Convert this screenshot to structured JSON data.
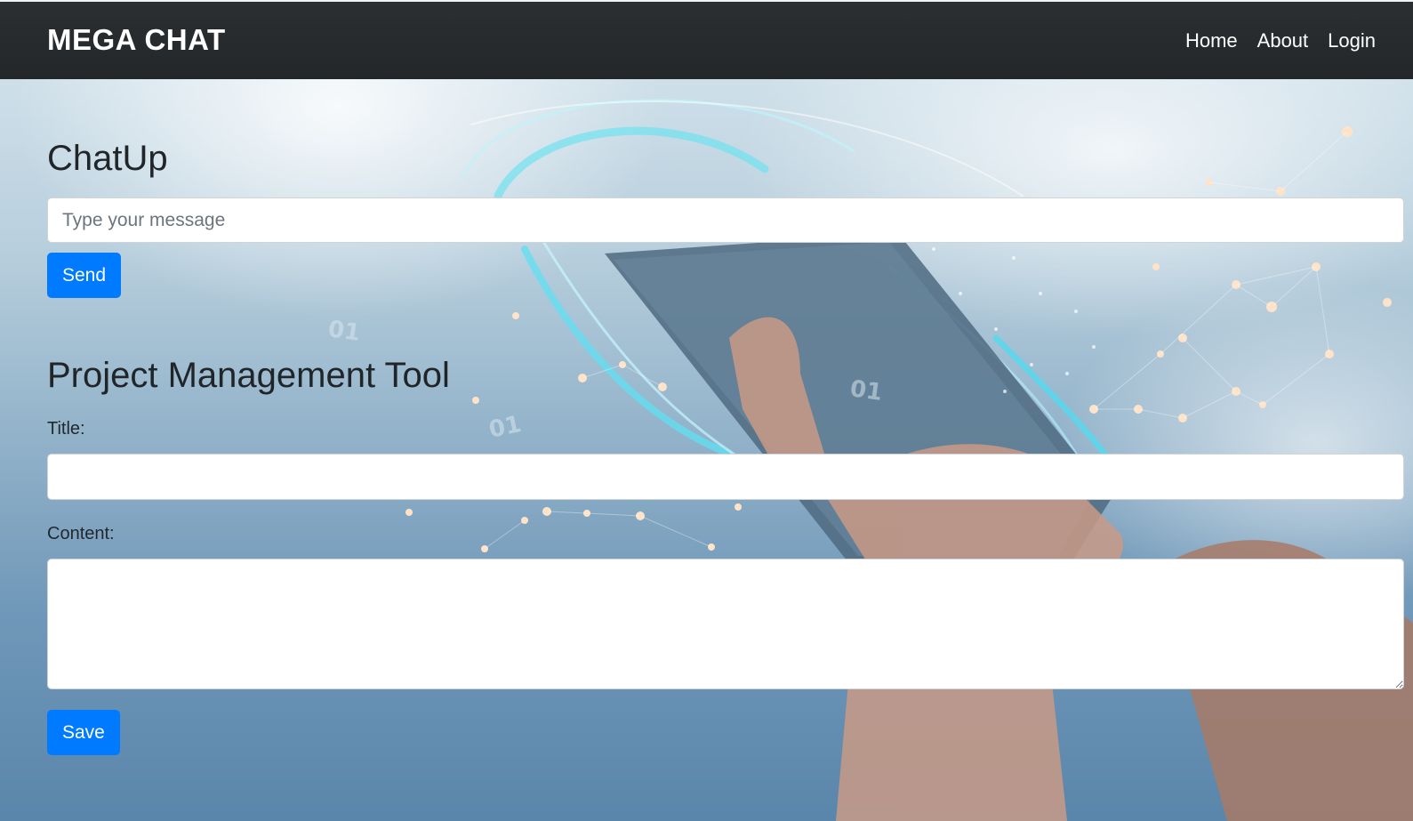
{
  "navbar": {
    "brand": "MEGA CHAT",
    "links": [
      {
        "label": "Home"
      },
      {
        "label": "About"
      },
      {
        "label": "Login"
      }
    ]
  },
  "chat": {
    "heading": "ChatUp",
    "message_input": {
      "placeholder": "Type your message",
      "value": ""
    },
    "send_label": "Send"
  },
  "project": {
    "heading": "Project Management Tool",
    "title_label": "Title:",
    "title_value": "",
    "content_label": "Content:",
    "content_value": "",
    "save_label": "Save"
  },
  "background": {
    "description_icon": "hand-holding-smartphone-network-image",
    "overlay_text": [
      "01",
      "01",
      "01"
    ]
  },
  "colors": {
    "navbar_bg": "#23272a",
    "primary_button": "#007bff",
    "heading_text": "#1f2529"
  }
}
